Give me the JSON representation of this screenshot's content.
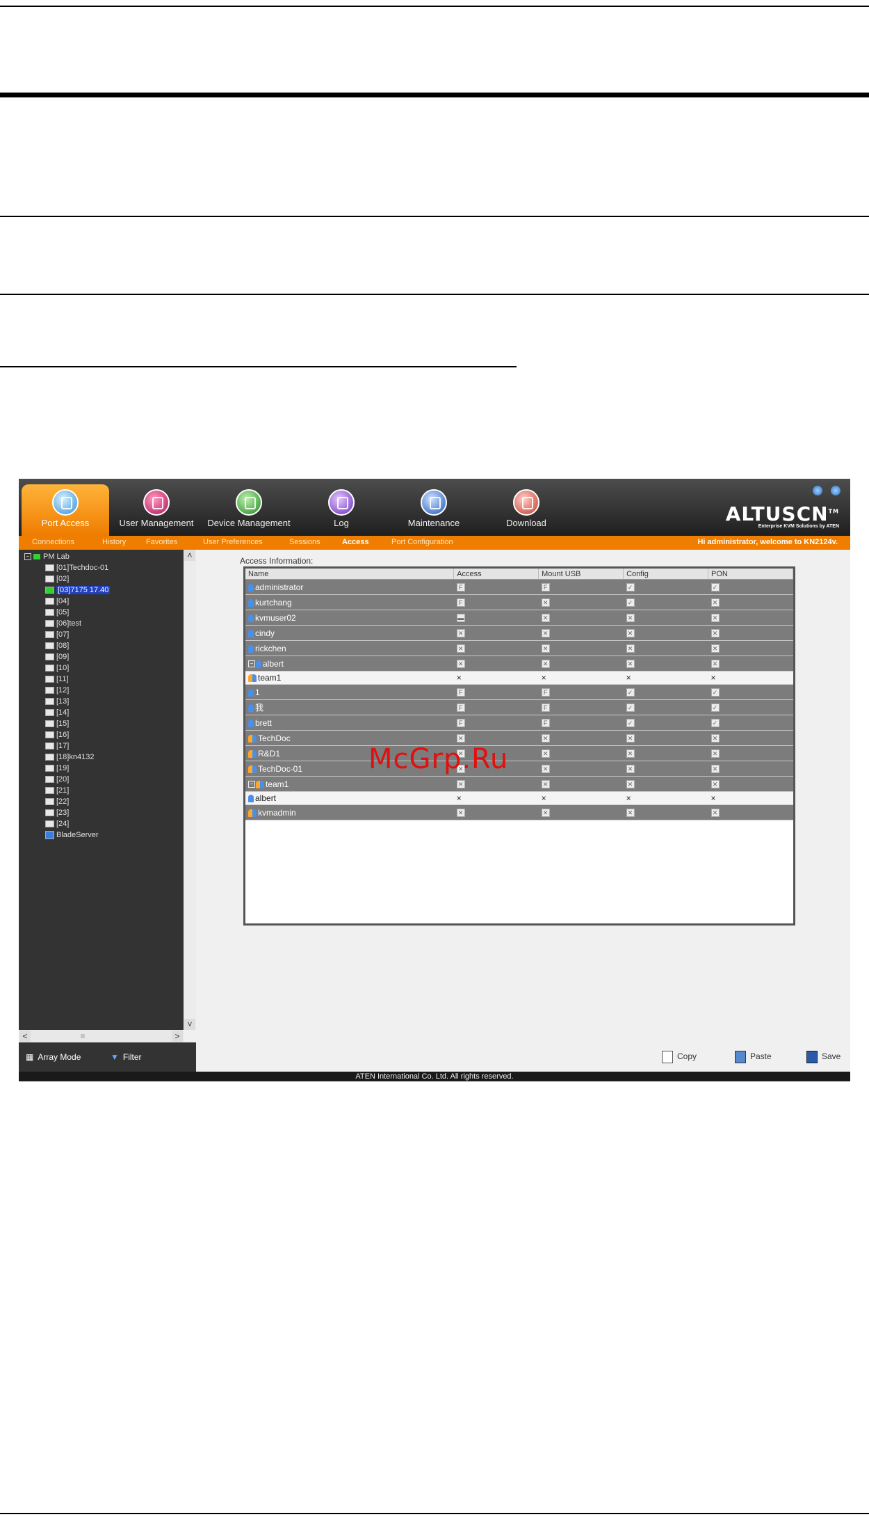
{
  "watermark": "McGrp.Ru",
  "nav": {
    "tabs": [
      {
        "label": "Port Access",
        "icon": "port-access-icon"
      },
      {
        "label": "User Management",
        "icon": "user-management-icon"
      },
      {
        "label": "Device Management",
        "icon": "device-management-icon"
      },
      {
        "label": "Log",
        "icon": "log-icon"
      },
      {
        "label": "Maintenance",
        "icon": "maintenance-icon"
      },
      {
        "label": "Download",
        "icon": "download-icon"
      }
    ],
    "active": "Port Access"
  },
  "brand": {
    "logo": "ALTUSCN",
    "tm": "TM",
    "tagline": "Enterprise KVM Solutions by ATEN"
  },
  "subtabs": [
    "Connections",
    "History",
    "Favorites",
    "User Preferences",
    "Sessions",
    "Access",
    "Port Configuration"
  ],
  "subtab_active": "Access",
  "welcome": "Hi administrator, welcome to KN2124v.",
  "tree": {
    "root": "PM Lab",
    "items": [
      "[01]Techdoc-01",
      "[02]",
      "[03]7175 17.40",
      "[04]",
      "[05]",
      "[06]test",
      "[07]",
      "[08]",
      "[09]",
      "[10]",
      "[11]",
      "[12]",
      "[13]",
      "[14]",
      "[15]",
      "[16]",
      "[17]",
      "[18]kn4132",
      "[19]",
      "[20]",
      "[21]",
      "[22]",
      "[23]",
      "[24]",
      "BladeServer"
    ],
    "selected": "[03]7175 17.40"
  },
  "bottom": {
    "array_mode": "Array Mode",
    "filter": "Filter"
  },
  "access": {
    "title": "Access Information:",
    "columns": [
      "Name",
      "Access",
      "Mount USB",
      "Config",
      "PON"
    ],
    "rows": [
      {
        "name": "administrator",
        "type": "user",
        "values": [
          "F",
          "F",
          "✓",
          "✓"
        ]
      },
      {
        "name": "kurtchang",
        "type": "user",
        "values": [
          "F",
          "✕",
          "✓",
          "✕"
        ]
      },
      {
        "name": "kvmuser02",
        "type": "user",
        "values": [
          "▬",
          "✕",
          "✕",
          "✕"
        ]
      },
      {
        "name": "cindy",
        "type": "user",
        "values": [
          "✕",
          "✕",
          "✕",
          "✕"
        ]
      },
      {
        "name": "rickchen",
        "type": "user",
        "values": [
          "✕",
          "✕",
          "✕",
          "✕"
        ]
      },
      {
        "name": "albert",
        "type": "user-expanded",
        "values": [
          "✕",
          "✕",
          "✕",
          "✕"
        ]
      },
      {
        "name": "team1",
        "type": "child-group",
        "values": [
          "×",
          "×",
          "×",
          "×"
        ]
      },
      {
        "name": "1",
        "type": "user",
        "values": [
          "F",
          "F",
          "✓",
          "✓"
        ]
      },
      {
        "name": "我",
        "type": "user",
        "values": [
          "F",
          "F",
          "✓",
          "✓"
        ]
      },
      {
        "name": "brett",
        "type": "user",
        "values": [
          "F",
          "F",
          "✓",
          "✓"
        ]
      },
      {
        "name": "TechDoc",
        "type": "group",
        "values": [
          "✕",
          "✕",
          "✕",
          "✕"
        ]
      },
      {
        "name": "R&D1",
        "type": "group",
        "values": [
          "✕",
          "✕",
          "✕",
          "✕"
        ]
      },
      {
        "name": "TechDoc-01",
        "type": "group",
        "values": [
          "✕",
          "✕",
          "✕",
          "✕"
        ]
      },
      {
        "name": "team1",
        "type": "group-expanded",
        "values": [
          "✕",
          "✕",
          "✕",
          "✕"
        ]
      },
      {
        "name": "albert",
        "type": "child-user",
        "values": [
          "×",
          "×",
          "×",
          "×"
        ]
      },
      {
        "name": "kvmadmin",
        "type": "group",
        "values": [
          "✕",
          "✕",
          "✕",
          "✕"
        ]
      }
    ]
  },
  "actions": {
    "copy": "Copy",
    "paste": "Paste",
    "save": "Save"
  },
  "footer": "ATEN International Co. Ltd. All rights reserved."
}
